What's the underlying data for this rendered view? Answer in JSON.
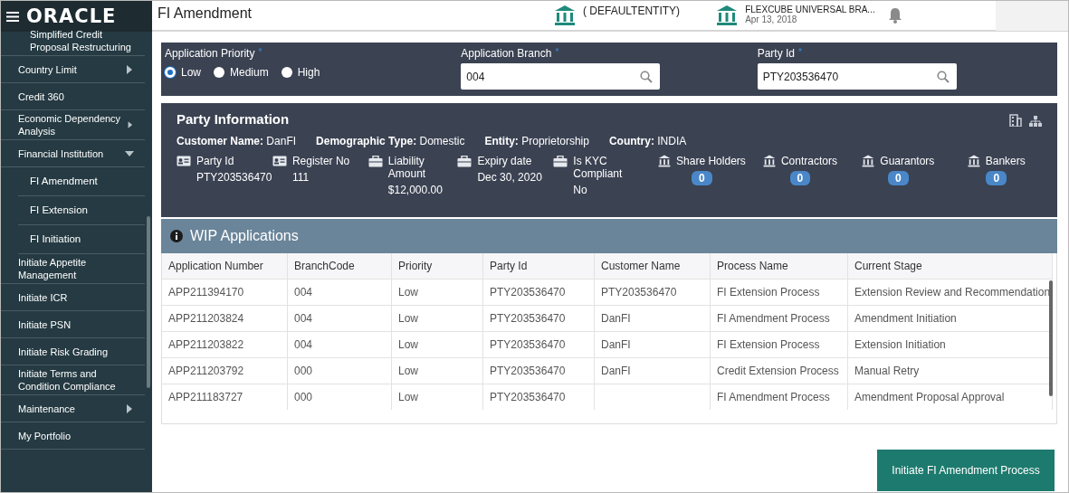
{
  "app": {
    "logo": "ORACLE"
  },
  "sidebar": {
    "items": [
      {
        "kind": "link",
        "label": "Simplified Credit Proposal Restructuring"
      },
      {
        "kind": "menu",
        "label": "Country Limit",
        "expanded": false
      },
      {
        "kind": "link",
        "label": "Credit 360"
      },
      {
        "kind": "menu",
        "label": "Economic Dependency Analysis",
        "expanded": false
      },
      {
        "kind": "menu",
        "label": "Financial Institution",
        "expanded": true,
        "children": [
          {
            "label": "FI Amendment"
          },
          {
            "label": "FI Extension"
          },
          {
            "label": "FI Initiation"
          }
        ]
      },
      {
        "kind": "link",
        "label": "Initiate Appetite Management"
      },
      {
        "kind": "link",
        "label": "Initiate ICR"
      },
      {
        "kind": "link",
        "label": "Initiate PSN"
      },
      {
        "kind": "link",
        "label": "Initiate Risk Grading"
      },
      {
        "kind": "link",
        "label": "Initiate Terms and Condition Compliance"
      },
      {
        "kind": "menu",
        "label": "Maintenance",
        "expanded": false
      },
      {
        "kind": "link",
        "label": "My Portfolio"
      }
    ]
  },
  "header": {
    "title": "FI Amendment",
    "entity": "( DEFAULTENTITY)",
    "branch": "FLEXCUBE UNIVERSAL BRA...",
    "date": "Apr 13, 2018"
  },
  "form": {
    "priority": {
      "label": "Application Priority",
      "required_mark": "*",
      "options": [
        {
          "label": "Low",
          "selected": true
        },
        {
          "label": "Medium",
          "selected": false
        },
        {
          "label": "High",
          "selected": false
        }
      ]
    },
    "fields": [
      {
        "label": "Application Branch",
        "required_mark": "*",
        "value": "004"
      },
      {
        "label": "Party Id",
        "required_mark": "*",
        "value": "PTY203536470"
      }
    ]
  },
  "party_info": {
    "title": "Party Information",
    "summary": [
      {
        "label": "Customer Name:",
        "value": "DanFI"
      },
      {
        "label": "Demographic Type:",
        "value": "Domestic"
      },
      {
        "label": "Entity:",
        "value": "Proprietorship"
      },
      {
        "label": "Country:",
        "value": "INDIA"
      }
    ],
    "details": [
      {
        "kind": "card",
        "label": "Party Id",
        "value": "PTY203536470"
      },
      {
        "kind": "card",
        "label": "Register No",
        "value": "111"
      },
      {
        "kind": "briefcase",
        "label": "Liability Amount",
        "value": "$12,000.00"
      },
      {
        "kind": "briefcase",
        "label": "Expiry date",
        "value": "Dec 30, 2020"
      },
      {
        "kind": "briefcase",
        "label": "Is KYC Compliant",
        "value": "No"
      }
    ],
    "relations": [
      {
        "label": "Share Holders",
        "count": "0"
      },
      {
        "label": "Contractors",
        "count": "0"
      },
      {
        "label": "Guarantors",
        "count": "0"
      },
      {
        "label": "Bankers",
        "count": "0"
      }
    ]
  },
  "wip": {
    "title": "WIP Applications",
    "columns": [
      "Application Number",
      "BranchCode",
      "Priority",
      "Party Id",
      "Customer Name",
      "Process Name",
      "Current Stage"
    ],
    "rows": [
      {
        "application_number": "APP211394170",
        "branch_code": "004",
        "priority": "Low",
        "party_id": "PTY203536470",
        "customer_name": "PTY203536470",
        "process_name": "FI Extension Process",
        "current_stage": "Extension Review and Recommendation"
      },
      {
        "application_number": "APP211203824",
        "branch_code": "004",
        "priority": "Low",
        "party_id": "PTY203536470",
        "customer_name": "DanFI",
        "process_name": "FI Amendment Process",
        "current_stage": "Amendment Initiation"
      },
      {
        "application_number": "APP211203822",
        "branch_code": "004",
        "priority": "Low",
        "party_id": "PTY203536470",
        "customer_name": "DanFI",
        "process_name": "FI Extension Process",
        "current_stage": "Extension Initiation"
      },
      {
        "application_number": "APP211203792",
        "branch_code": "000",
        "priority": "Low",
        "party_id": "PTY203536470",
        "customer_name": "DanFI",
        "process_name": "Credit Extension Process",
        "current_stage": "Manual Retry"
      },
      {
        "application_number": "APP211183727",
        "branch_code": "000",
        "priority": "Low",
        "party_id": "PTY203536470",
        "process_name": "FI Amendment Process",
        "current_stage": "Amendment Proposal Approval"
      }
    ]
  },
  "actions": {
    "primary": "Initiate FI Amendment Process"
  }
}
